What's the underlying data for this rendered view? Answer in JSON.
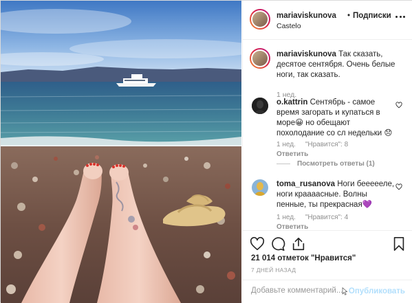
{
  "header": {
    "username": "mariaviskunova",
    "dot": "•",
    "follow_label": "Подписки",
    "location": "Castelo"
  },
  "caption": {
    "username": "mariaviskunova",
    "text": "Так сказать, десятое сентября. Очень белые ноги, так сказать.",
    "time": "1 нед."
  },
  "comments": [
    {
      "username": "o.kattrin",
      "text_before": "Сентябрь - самое время загорать и купаться в море",
      "emoji_1": "😀",
      "text_after": " но обещают похолодание со сл недельки ",
      "emoji_2": "😞",
      "time": "1 нед.",
      "likes": "\"Нравится\": 8",
      "reply": "Ответить",
      "view_replies": "Посмотреть ответы (1)"
    },
    {
      "username": "toma_rusanova",
      "text": "Ноги беееееле, ноги краааасные. Волны пенные, ты прекрасная",
      "emoji": "💜",
      "time": "1 нед.",
      "likes": "\"Нравится\": 4",
      "reply": "Ответить"
    }
  ],
  "actions": {
    "icons": [
      "heart-icon",
      "comment-icon",
      "share-icon",
      "bookmark-icon"
    ],
    "likes_text": "21 014 отметок \"Нравится\"",
    "posted_ago": "7 ДНЕЙ НАЗАД"
  },
  "add_comment": {
    "placeholder": "Добавьте комментарий...",
    "publish_label": "Опубликовать"
  },
  "colors": {
    "text": "#262626",
    "muted": "#8e8e8e",
    "publish_disabled": "#b2dffc",
    "border": "#efefef"
  }
}
